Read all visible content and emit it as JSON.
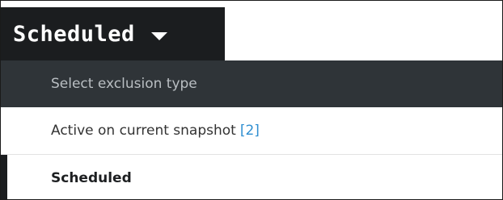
{
  "dropdown": {
    "selected_label": "Scheduled"
  },
  "menu": {
    "header": "Select exclusion type",
    "items": [
      {
        "label": "Active on current snapshot",
        "count": "[2]"
      },
      {
        "label": "Scheduled"
      }
    ]
  }
}
